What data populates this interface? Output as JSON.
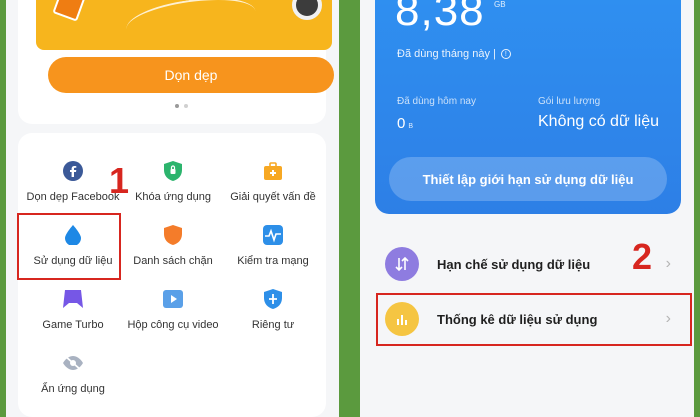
{
  "left": {
    "clean_button": "Dọn dẹp",
    "tools": [
      {
        "label": "Dọn dẹp Facebook",
        "icon": "facebook-icon",
        "color": "#3b5998"
      },
      {
        "label": "Khóa ứng dụng",
        "icon": "shield-lock-icon",
        "color": "#2cb46d"
      },
      {
        "label": "Giải quyết vấn đề",
        "icon": "toolbox-icon",
        "color": "#f7a823"
      },
      {
        "label": "Sử dụng dữ liệu",
        "icon": "water-drop-icon",
        "color": "#1e88e5"
      },
      {
        "label": "Danh sách chặn",
        "icon": "block-shield-icon",
        "color": "#f47c2a"
      },
      {
        "label": "Kiểm tra mạng",
        "icon": "network-pulse-icon",
        "color": "#2d8fe8"
      },
      {
        "label": "Game Turbo",
        "icon": "gamepad-icon",
        "color": "#7657e6"
      },
      {
        "label": "Hộp công cụ video",
        "icon": "video-toolbox-icon",
        "color": "#5aa0e8"
      },
      {
        "label": "Riêng tư",
        "icon": "privacy-icon",
        "color": "#2d8fe8"
      },
      {
        "label": "Ẩn ứng dụng",
        "icon": "eye-off-icon",
        "color": "#a9b2c1"
      }
    ],
    "step": "1"
  },
  "right": {
    "month_value": "8,38",
    "month_unit": "GB",
    "month_label": "Đã dùng tháng này |",
    "today_label": "Đã dùng hôm nay",
    "today_value": "0",
    "today_unit": "B",
    "plan_label": "Gói lưu lượng",
    "plan_value": "Không có dữ liệu",
    "limit_button": "Thiết lập giới hạn sử dụng dữ liệu",
    "rows": [
      {
        "label": "Hạn chế sử dụng dữ liệu",
        "icon": "restrict-data-icon",
        "color": "#8e7ce0"
      },
      {
        "label": "Thống kê dữ liệu sử dụng",
        "icon": "stats-icon",
        "color": "#f5c542"
      }
    ],
    "step": "2"
  },
  "colors": {
    "accent_red": "#d7261f",
    "brand_blue": "#2f8ff0",
    "orange": "#f7941d"
  }
}
